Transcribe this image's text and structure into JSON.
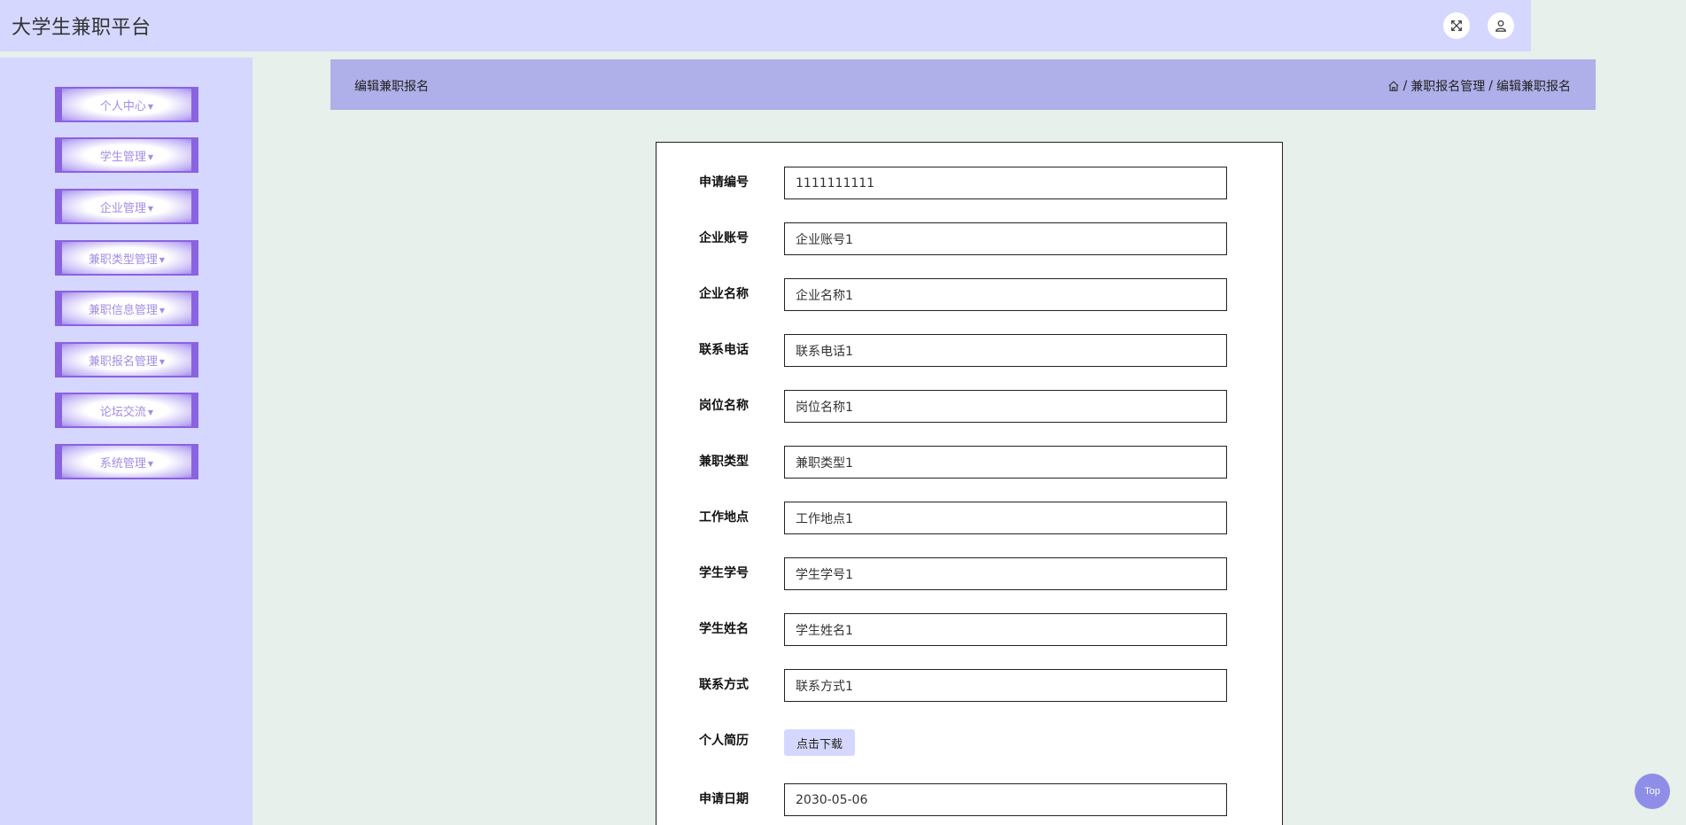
{
  "app": {
    "title": "大学生兼职平台"
  },
  "header": {
    "fullscreen_icon": "fullscreen-icon",
    "user_icon": "user-icon"
  },
  "sidebar": {
    "items": [
      {
        "label": "个人中心"
      },
      {
        "label": "学生管理"
      },
      {
        "label": "企业管理"
      },
      {
        "label": "兼职类型管理"
      },
      {
        "label": "兼职信息管理"
      },
      {
        "label": "兼职报名管理"
      },
      {
        "label": "论坛交流"
      },
      {
        "label": "系统管理"
      }
    ]
  },
  "content": {
    "title": "编辑兼职报名",
    "breadcrumb": {
      "home_icon": "home-icon",
      "sep1": "/",
      "level1": "兼职报名管理",
      "sep2": "/",
      "level2": "编辑兼职报名"
    }
  },
  "form": {
    "fields": [
      {
        "label": "申请编号",
        "value": "1111111111"
      },
      {
        "label": "企业账号",
        "value": "企业账号1"
      },
      {
        "label": "企业名称",
        "value": "企业名称1"
      },
      {
        "label": "联系电话",
        "value": "联系电话1"
      },
      {
        "label": "岗位名称",
        "value": "岗位名称1"
      },
      {
        "label": "兼职类型",
        "value": "兼职类型1"
      },
      {
        "label": "工作地点",
        "value": "工作地点1"
      },
      {
        "label": "学生学号",
        "value": "学生学号1"
      },
      {
        "label": "学生姓名",
        "value": "学生姓名1"
      },
      {
        "label": "联系方式",
        "value": "联系方式1"
      }
    ],
    "resume": {
      "label": "个人简历",
      "button": "点击下载"
    },
    "date": {
      "label": "申请日期",
      "value": "2030-05-06"
    }
  },
  "back_to_top": {
    "label": "Top"
  },
  "colors": {
    "header_bg": "#d5d7ff",
    "sidebar_bg": "#d5d7ff",
    "menu_accent": "#8a63e0",
    "content_header_bg": "#afafe9",
    "page_bg": "#e7f0ea",
    "top_button": "#8e8ee8"
  }
}
